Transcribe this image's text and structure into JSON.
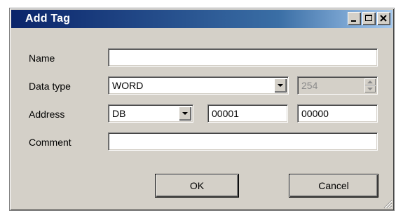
{
  "window": {
    "title": "Add Tag",
    "title_icons": [
      "minimize-icon",
      "maximize-icon",
      "close-icon"
    ]
  },
  "form": {
    "name_label": "Name",
    "name_value": "",
    "datatype_label": "Data type",
    "datatype_value": "WORD",
    "length_value": "254",
    "address_label": "Address",
    "address_area": "DB",
    "address_db": "00001",
    "address_offset": "00000",
    "comment_label": "Comment",
    "comment_value": ""
  },
  "buttons": {
    "ok": "OK",
    "cancel": "Cancel"
  },
  "colors": {
    "title_start": "#0a246a",
    "title_end": "#a6caf0",
    "face": "#d4d0c8"
  }
}
